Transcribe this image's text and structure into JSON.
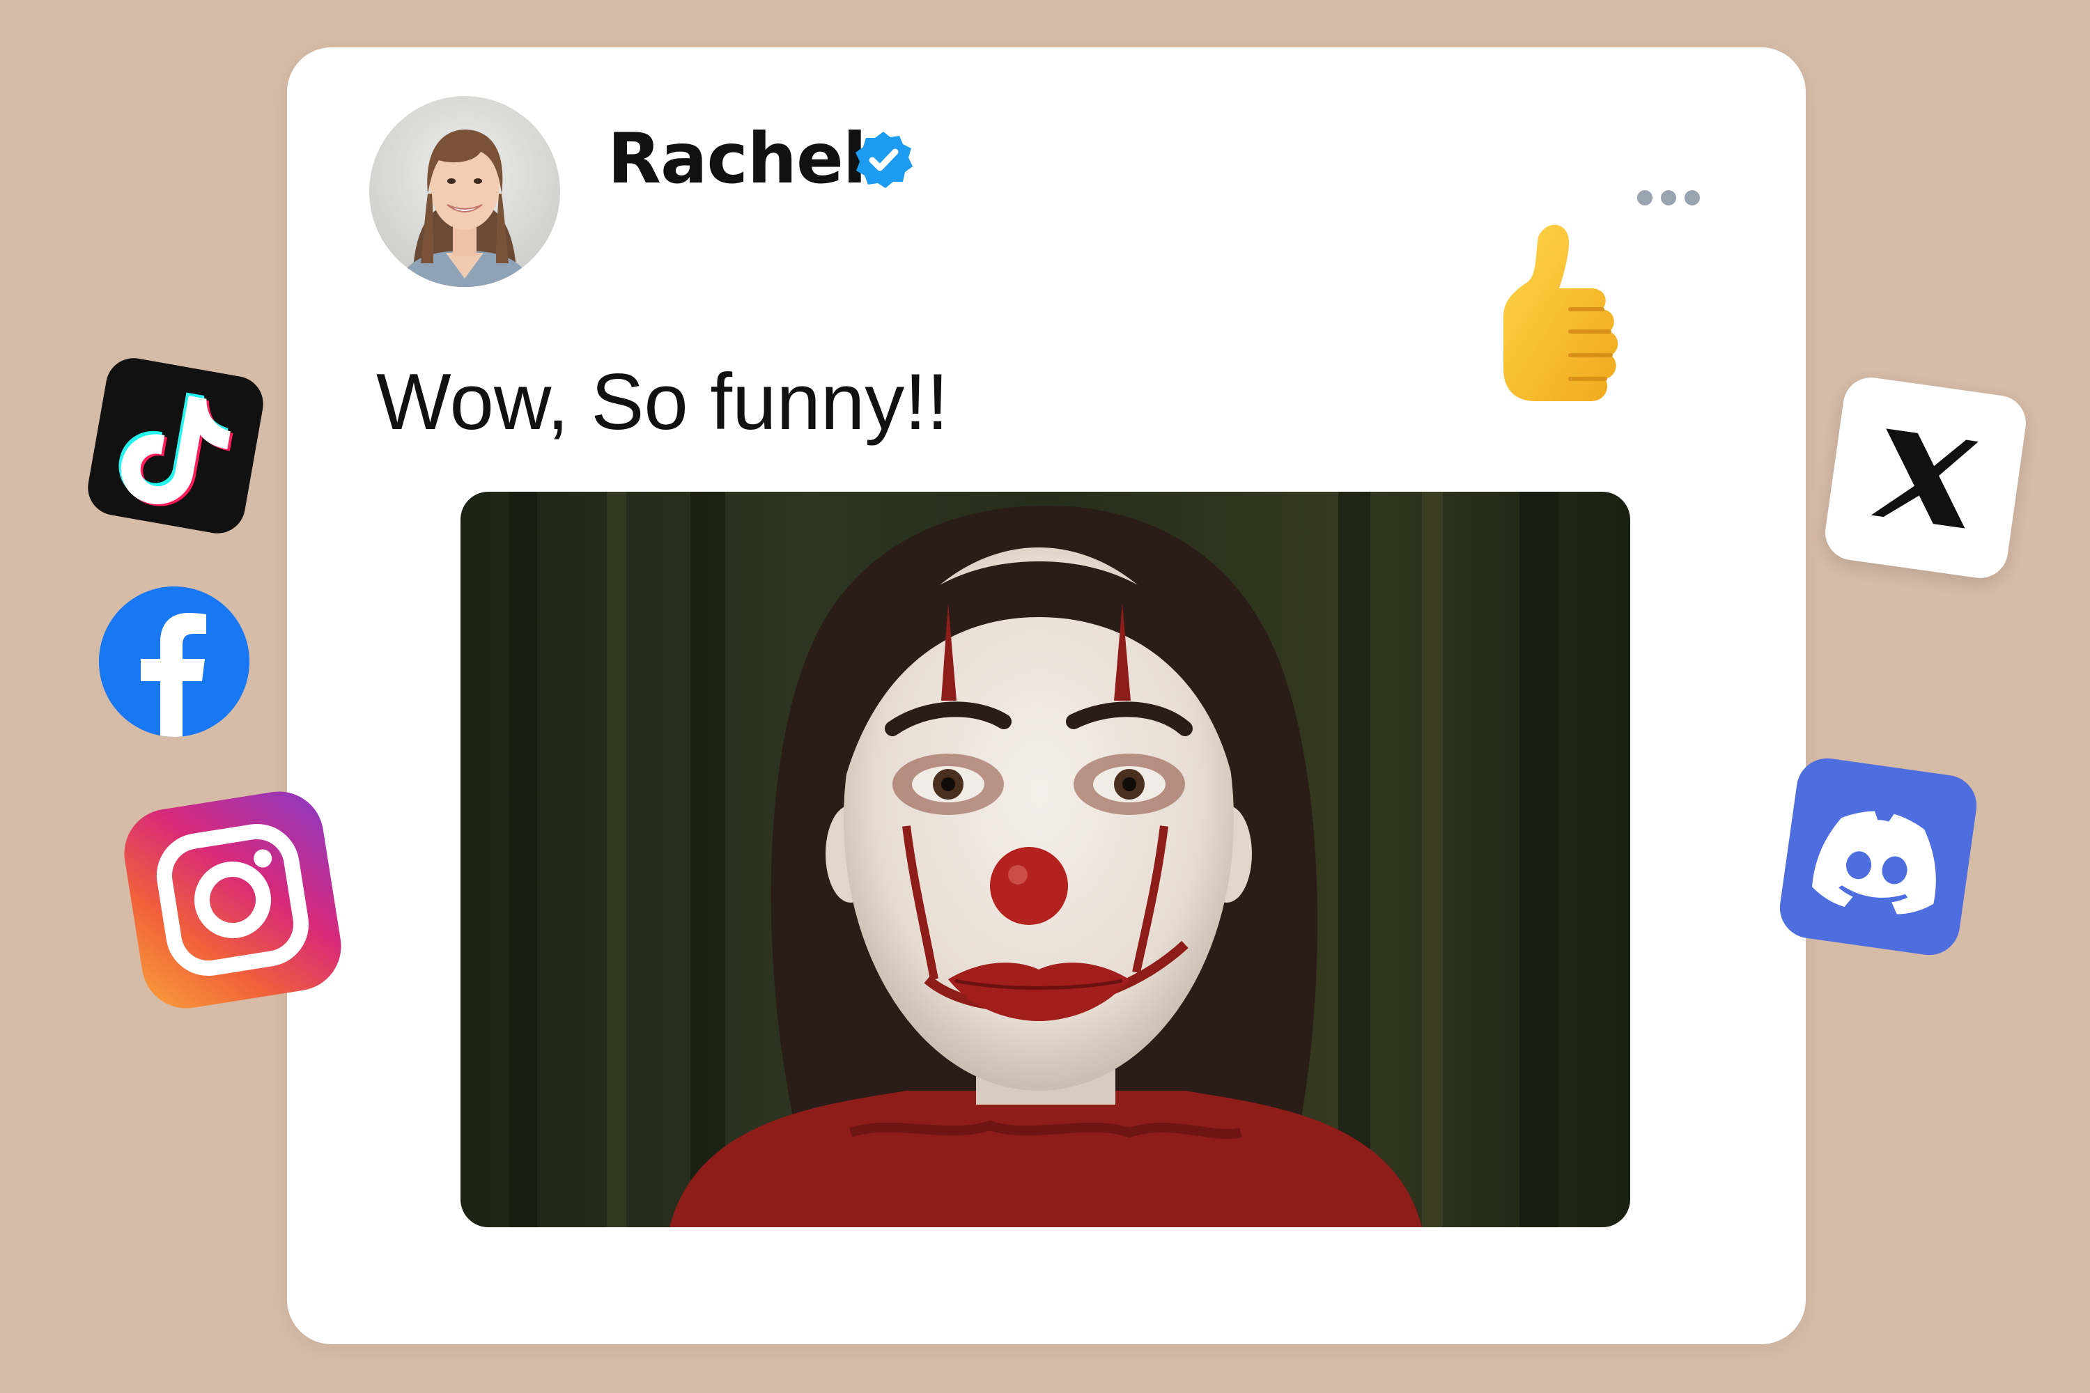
{
  "post": {
    "author": "Rachel",
    "verified": true,
    "text": "Wow, So funny!!",
    "reaction": "thumbs-up-icon",
    "image": "clown-makeup-portrait"
  },
  "social_icons": [
    "tiktok-icon",
    "facebook-icon",
    "instagram-icon",
    "x-icon",
    "discord-icon"
  ],
  "colors": {
    "background": "#d6bba6",
    "card": "#ffffff",
    "verified": "#1d9bf0",
    "facebook": "#1877f2",
    "discord": "#4e6ee0"
  }
}
